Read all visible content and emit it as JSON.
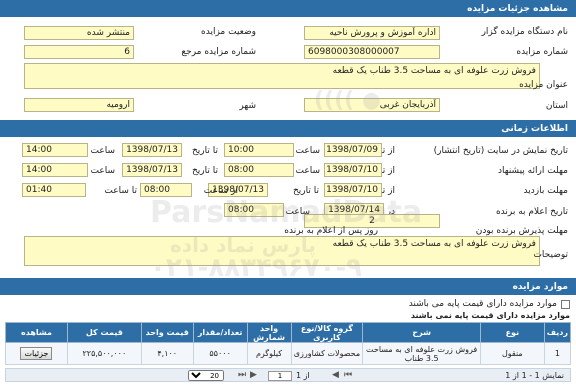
{
  "sections": {
    "details": "مشاهده جزئیات مزایده",
    "timing": "اطلاعات زمانی",
    "items": "موارد مزایده"
  },
  "details": {
    "organizer_label": "نام دستگاه مزایده گزار",
    "organizer_value": "اداره آموزش و پرورش ناحیه",
    "status_label": "وضعیت مزایده",
    "status_value": "منتشر شده",
    "number_label": "شماره مزایده",
    "number_value": "6098000308000007",
    "ref_label": "شماره مزایده مرجع",
    "ref_value": "6",
    "title_label": "عنوان مزایده",
    "title_value": "فروش زرت علوفه ای به مساحت 3.5 طناب یک قطعه",
    "province_label": "استان",
    "province_value": "آذربایجان غربی",
    "city_label": "شهر",
    "city_value": "ارومیه"
  },
  "timing": {
    "display_label": "تاریخ نمایش در سایت (تاریخ انتشار)",
    "from_date_label": "از تاریخ",
    "to_date_label": "تا تاریخ",
    "hour_label": "ساعت",
    "from_hour_label": "از ساعت",
    "to_hour_label": "تا ساعت",
    "display_from_date": "1398/07/09",
    "display_from_hour": "10:00",
    "display_to_date": "1398/07/13",
    "display_to_hour": "14:00",
    "offer_label": "مهلت ارائه پیشنهاد",
    "offer_from_date": "1398/07/10",
    "offer_from_hour": "08:00",
    "offer_to_date": "1398/07/13",
    "offer_to_hour": "14:00",
    "visit_label": "مهلت بازدید",
    "visit_from_date": "1398/07/10",
    "visit_to_date": "1398/07/13",
    "visit_from_hour": "08:00",
    "visit_to_hour": "01:40",
    "winner_label": "تاریخ اعلام به برنده",
    "winner_date_label": "در تاریخ",
    "winner_date": "1398/07/14",
    "winner_hour": "08:00",
    "accept_label": "مهلت پذیرش برنده بودن",
    "accept_days": "2",
    "accept_note": "روز پس از اعلام به برنده",
    "desc_label": "توضیحات",
    "desc_value": "فروش زرت علوفه ای به مساحت 3.5 طناب یک قطعه"
  },
  "items": {
    "checkbox_label": "موارد مزایده دارای قیمت پایه می باشند",
    "subtitle": "موارد مزایده دارای قیمت پایه نمی باشند",
    "columns": [
      "ردیف",
      "نوع",
      "شرح",
      "گروه کالا/نوع کاربری",
      "واحد شمارش",
      "تعداد/مقدار",
      "قیمت واحد",
      "قیمت کل",
      "مشاهده"
    ],
    "rows": [
      {
        "row": "1",
        "type": "منقول",
        "desc": "فروش زرت علوفه ای به مساحت 3.5 طناب",
        "group": "محصولات کشاورزی",
        "unit": "کیلوگرم",
        "qty": "۵۵۰۰۰",
        "unit_price": "۴,۱۰۰",
        "total": "۲۲۵,۵۰۰,۰۰۰",
        "view_label": "جزئیات"
      }
    ],
    "pager": {
      "page_value": "1",
      "page_total": "از 1",
      "page_size": "20",
      "summary": "نمایش 1 - 1 از 1"
    }
  },
  "watermark": {
    "brand": "ParsNamadData",
    "site": "پارس نماد داده",
    "phone": "۰۲۱-۸۸۳۴۹۶۷۰-۹"
  }
}
